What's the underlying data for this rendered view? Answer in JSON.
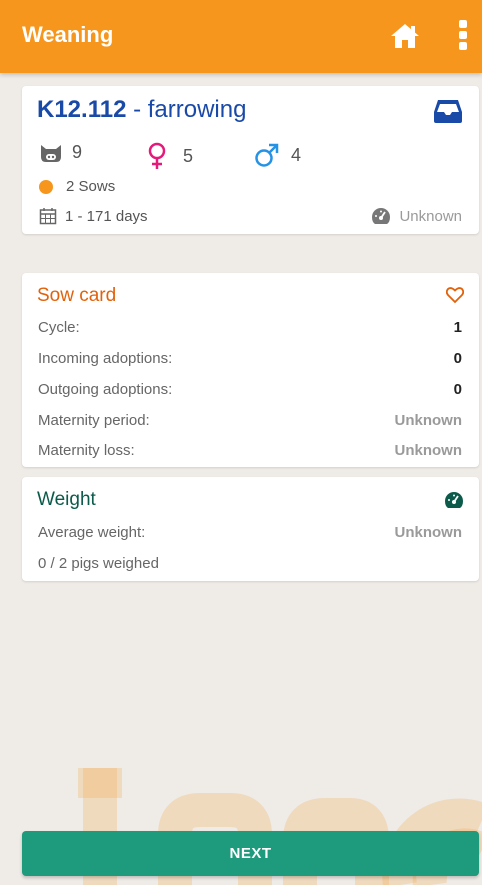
{
  "appbar": {
    "title": "Weaning"
  },
  "group": {
    "code": "K12.112",
    "separator": " - ",
    "status": "farrowing",
    "total_pigs": "9",
    "female_count": "5",
    "male_count": "4",
    "sows": "2 Sows",
    "age_range": "1 - 171 days",
    "gauge_status": "Unknown"
  },
  "sow_card": {
    "title": "Sow card",
    "rows": [
      {
        "label": "Cycle:",
        "value": "1"
      },
      {
        "label": "Incoming adoptions:",
        "value": "0"
      },
      {
        "label": "Outgoing adoptions:",
        "value": "0"
      },
      {
        "label": "Maternity period:",
        "value": "Unknown"
      },
      {
        "label": "Maternity loss:",
        "value": "Unknown"
      }
    ]
  },
  "weight": {
    "title": "Weight",
    "average_label": "Average weight:",
    "average_value": "Unknown",
    "weighed": "0 / 2 pigs weighed"
  },
  "footer": {
    "next_label": "NEXT"
  },
  "colors": {
    "appbar": "#f6961d",
    "group_title": "#1a4aa8",
    "sow_title": "#e2620c",
    "weight_title": "#0c5a4a",
    "next_button": "#1e9a7c",
    "female": "#e5197a",
    "male": "#2493e6"
  }
}
